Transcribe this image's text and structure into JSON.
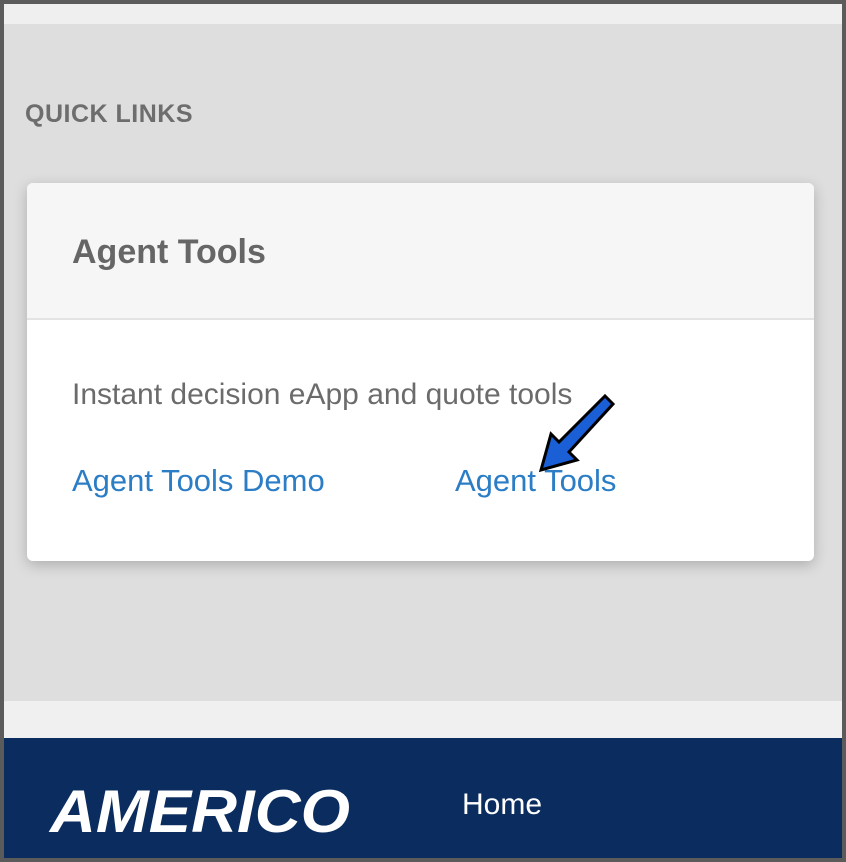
{
  "quick_links": {
    "heading": "QUICK LINKS"
  },
  "card": {
    "title": "Agent Tools",
    "description": "Instant decision eApp and quote tools",
    "links": [
      {
        "label": "Agent Tools Demo"
      },
      {
        "label": "Agent Tools"
      }
    ]
  },
  "footer": {
    "logo_text": "AMERICO",
    "nav": {
      "home_label": "Home"
    }
  },
  "colors": {
    "link": "#2b7dc6",
    "footer_bg": "#0b2c5e",
    "annotation_arrow": "#1a5fd6"
  },
  "icons": {
    "annotation": "arrow-down-left-icon"
  }
}
